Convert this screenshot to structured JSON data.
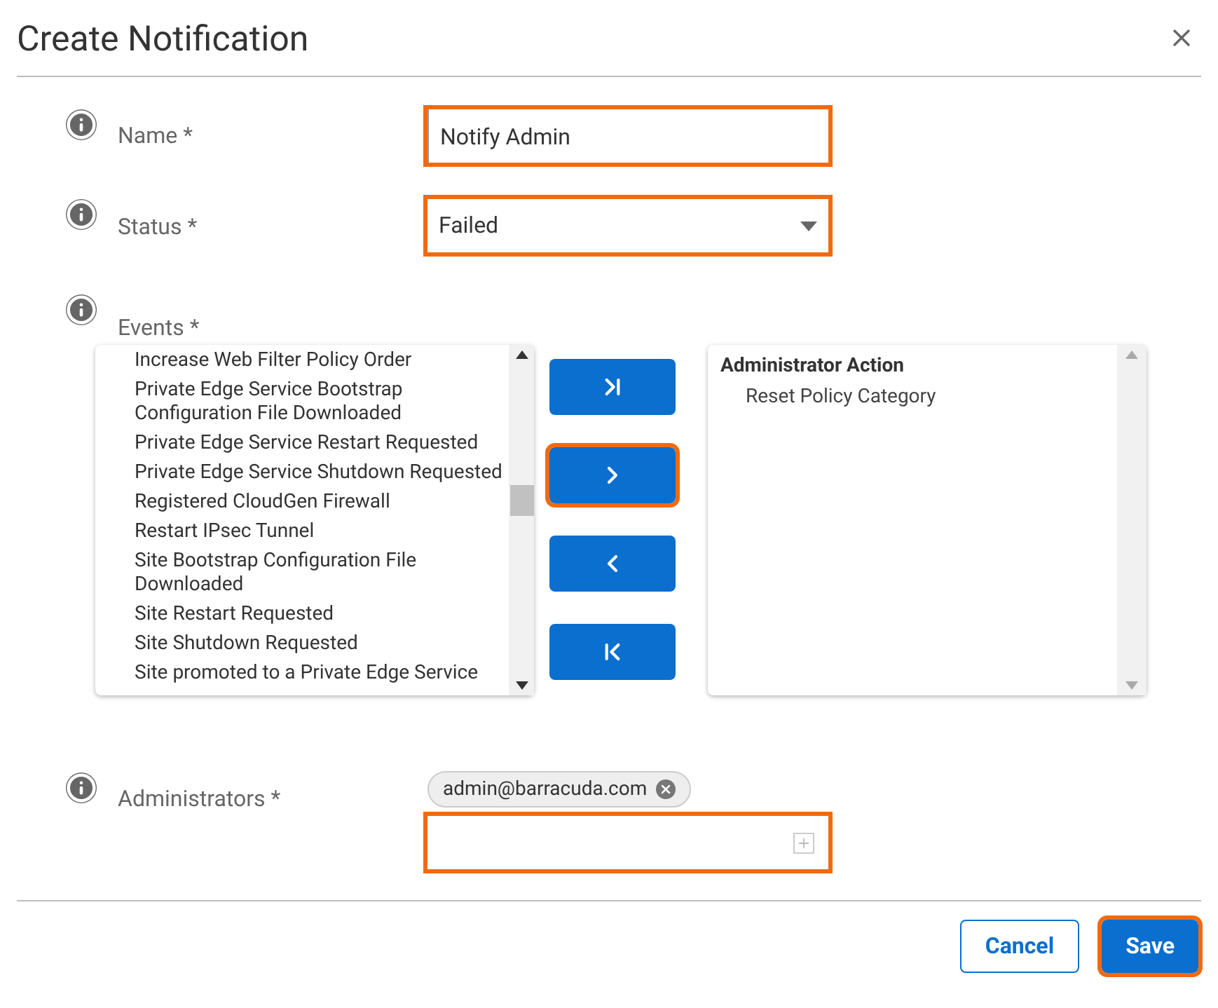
{
  "dialog": {
    "title": "Create Notification"
  },
  "name_field": {
    "label": "Name *",
    "value": "Notify Admin",
    "highlighted": true
  },
  "status_field": {
    "label": "Status *",
    "value": "Failed",
    "highlighted": true
  },
  "events": {
    "label": "Events *",
    "available": [
      "Increase Web Filter Policy Order",
      "Private Edge Service Bootstrap Configuration File Downloaded",
      "Private Edge Service Restart Requested",
      "Private Edge Service Shutdown Requested",
      "Registered CloudGen Firewall",
      "Restart IPsec Tunnel",
      "Site Bootstrap Configuration File Downloaded",
      "Site Restart Requested",
      "Site Shutdown Requested",
      "Site promoted to a Private Edge Service"
    ],
    "transfer_buttons": [
      {
        "kind": "all_right",
        "highlighted": false
      },
      {
        "kind": "right",
        "highlighted": true
      },
      {
        "kind": "left",
        "highlighted": false
      },
      {
        "kind": "all_left",
        "highlighted": false
      }
    ],
    "selected_groups": [
      {
        "group": "Administrator Action",
        "items": [
          "Reset Policy Category"
        ]
      }
    ]
  },
  "administrators": {
    "label": "Administrators *",
    "chips": [
      "admin@barracuda.com"
    ],
    "highlighted": true
  },
  "footer_buttons": [
    {
      "label": "Cancel",
      "kind": "secondary",
      "highlighted": false
    },
    {
      "label": "Save",
      "kind": "primary",
      "highlighted": true
    }
  ]
}
